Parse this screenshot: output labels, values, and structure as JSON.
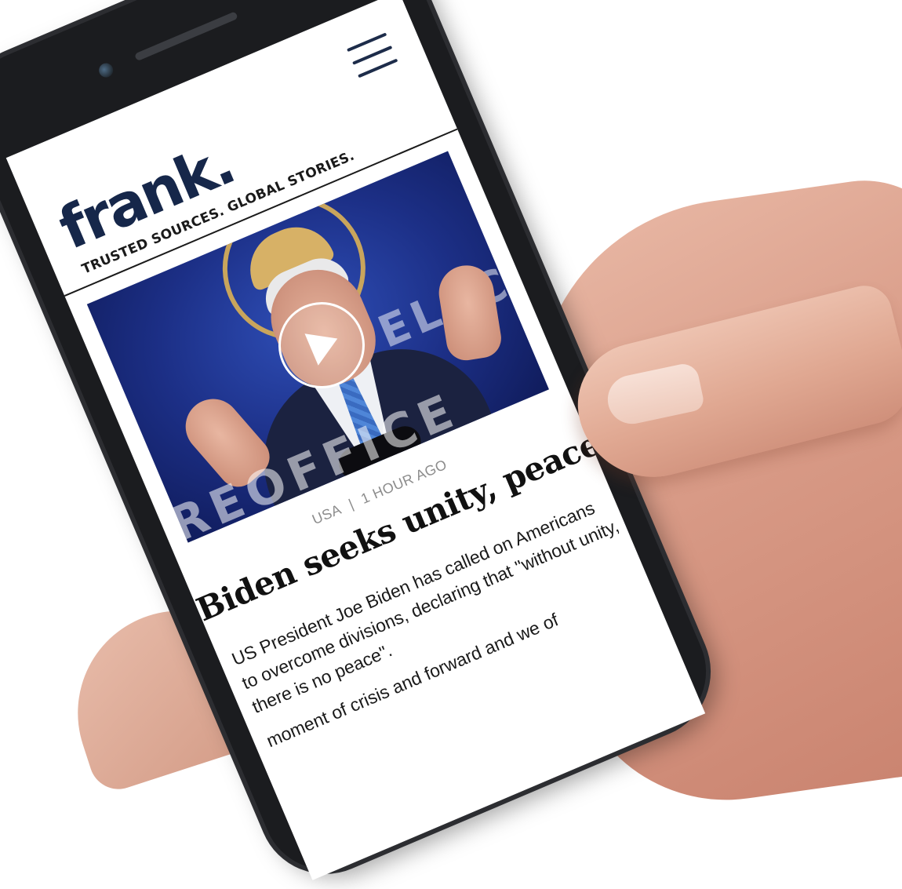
{
  "site": {
    "logo": "frank.",
    "tagline": "TRUSTED SOURCES. GLOBAL STORIES."
  },
  "header": {
    "menu_icon": "hamburger-menu-icon"
  },
  "video": {
    "play_icon": "play-icon",
    "backdrop_text_1": "REOFFICE",
    "backdrop_text_2": "ELEC"
  },
  "article": {
    "category": "USA",
    "separator": "|",
    "time": "1 HOUR AGO",
    "headline": "Biden seeks unity, peace",
    "summary_p1": "US President Joe Biden has called on Americans to overcome divisions, declaring that \"without unity, there is no peace\".",
    "summary_p2": "moment of crisis and forward and we of"
  },
  "colors": {
    "brand": "#16274a",
    "meta_gray": "#8c8c8c",
    "video_blue": "#1c2f86"
  }
}
